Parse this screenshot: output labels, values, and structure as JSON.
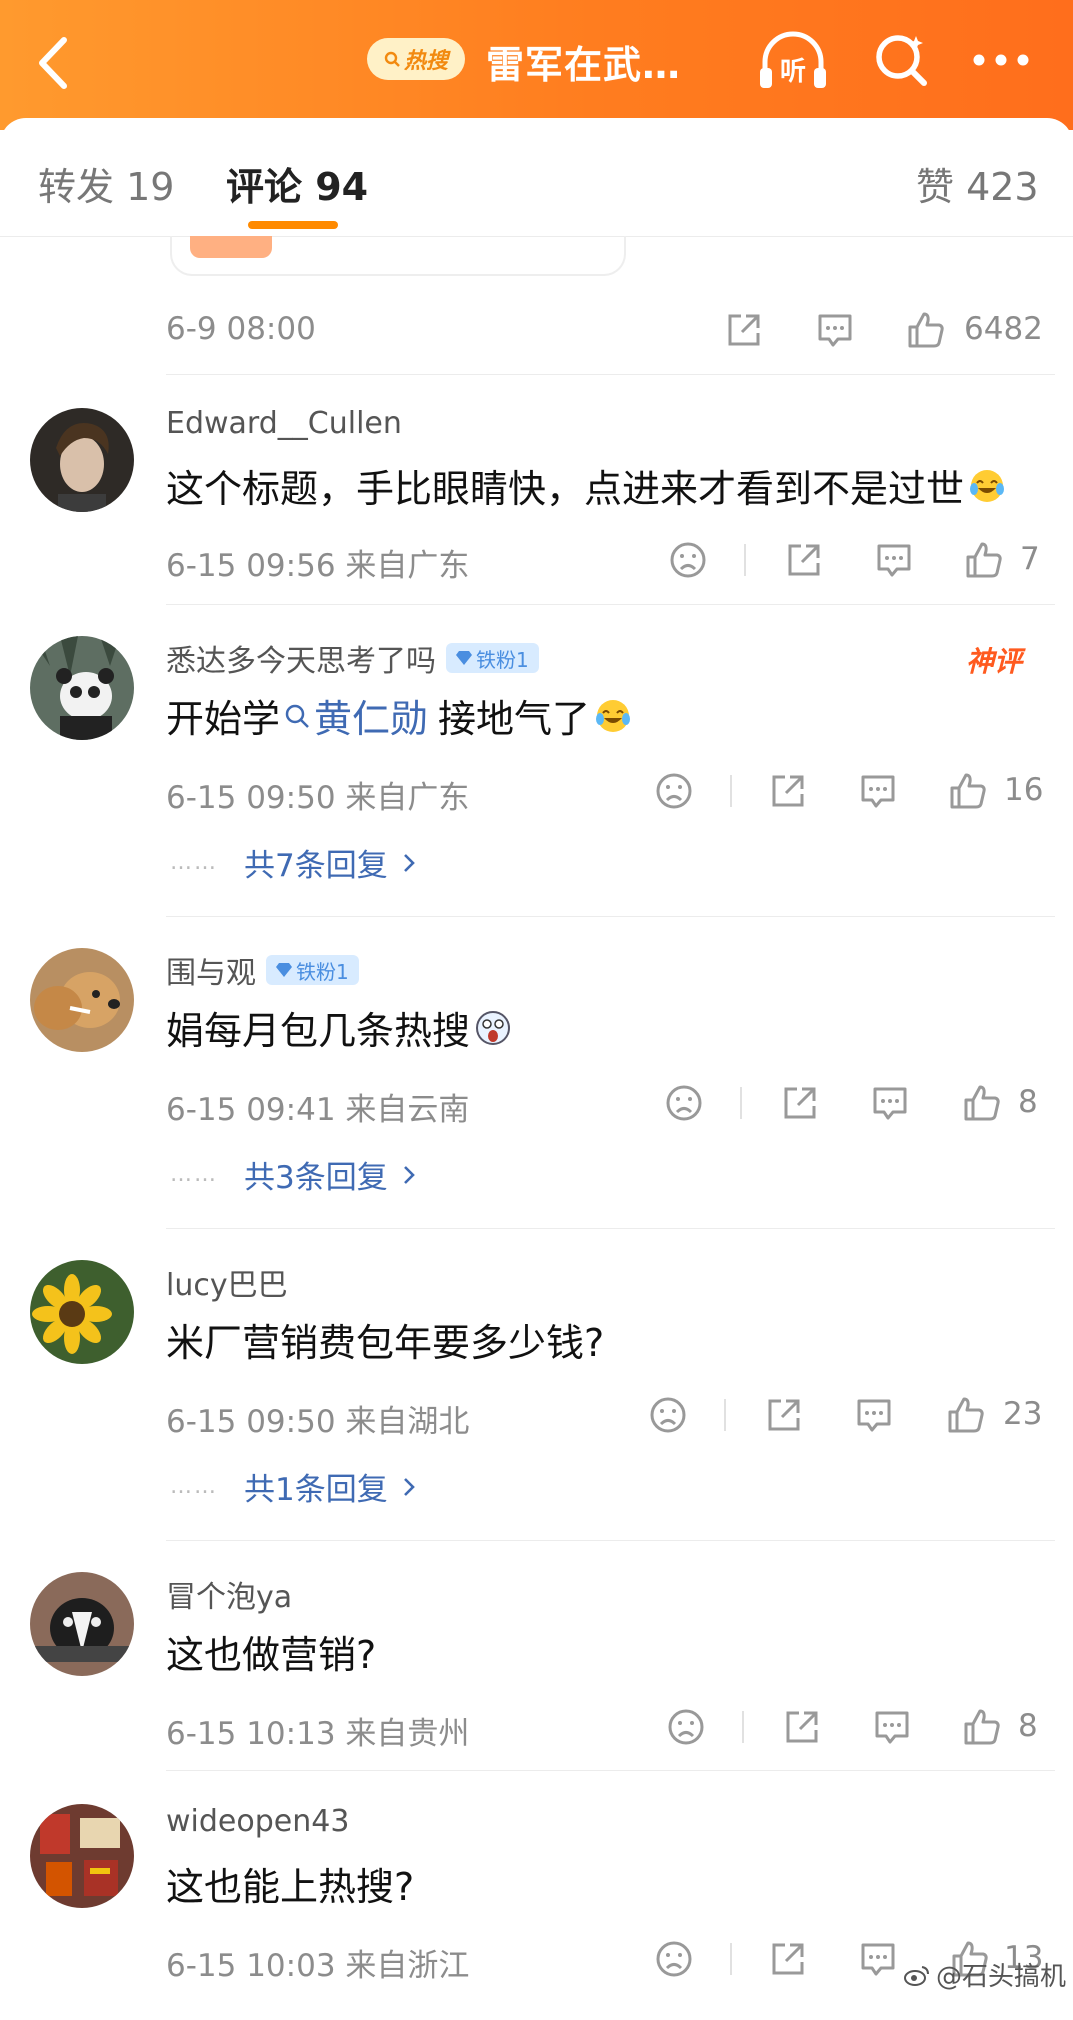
{
  "header": {
    "hot_badge": "热搜",
    "title": "雷军在武…",
    "listen_label": "听"
  },
  "tabs": {
    "repost": "转发 19",
    "comments": "评论 94",
    "likes": "赞 423"
  },
  "previous_post": {
    "time": "6-9 08:00",
    "likes": "6482"
  },
  "comments": [
    {
      "user": "Edward__Cullen",
      "badge": "",
      "text": "这个标题，手比眼睛快，点进来才看到不是过世",
      "meta": "6-15 09:56 来自广东",
      "likes": "7",
      "replies": ""
    },
    {
      "user": "悉达多今天思考了吗",
      "badge": "铁粉1",
      "text_before": "开始学",
      "topic": "黄仁勋",
      "text_after": "接地气了",
      "tag": "神评",
      "meta": "6-15 09:50 来自广东",
      "likes": "16",
      "replies": "共7条回复"
    },
    {
      "user": "围与观",
      "badge": "铁粉1",
      "text": "娟每月包几条热搜",
      "meta": "6-15 09:41 来自云南",
      "likes": "8",
      "replies": "共3条回复"
    },
    {
      "user": "lucy巴巴",
      "badge": "",
      "text": "米厂营销费包年要多少钱?",
      "meta": "6-15 09:50 来自湖北",
      "likes": "23",
      "replies": "共1条回复"
    },
    {
      "user": "冒个泡ya",
      "badge": "",
      "text": "这也做营销?",
      "meta": "6-15 10:13 来自贵州",
      "likes": "8",
      "replies": ""
    },
    {
      "user": "wideopen43",
      "badge": "",
      "text": "这也能上热搜?",
      "meta": "6-15 10:03 来自浙江",
      "likes": "13",
      "replies": ""
    }
  ],
  "reply_dots": "……",
  "watermark": "@石头搞机",
  "colors": {
    "header": "#ff7d1f",
    "accent": "#ff8a00",
    "link": "#3f6ab3",
    "badge_bg": "#d8ebff"
  }
}
